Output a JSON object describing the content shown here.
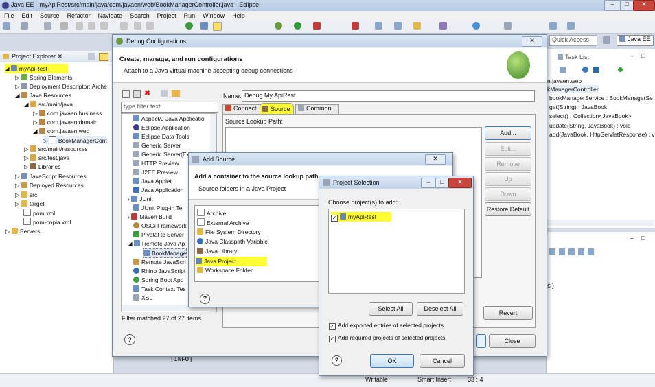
{
  "window": {
    "title": "Java EE - myApiRest/src/main/java/com/javaen/web/BookManagerController.java - Eclipse",
    "min": "–",
    "max": "□",
    "close": "✕"
  },
  "menu": [
    "File",
    "Edit",
    "Source",
    "Refactor",
    "Navigate",
    "Search",
    "Project",
    "Run",
    "Window",
    "Help"
  ],
  "quick_access": "Quick Access",
  "perspective": "Java EE",
  "explorer": {
    "title": "Project Explorer ✕",
    "items": [
      "myApiRest",
      "Spring Elements",
      "Deployment Descriptor: Arche",
      "Java Resources",
      "src/main/java",
      "com.javaen.business",
      "com.javaen.domain",
      "com.javaen.web",
      "BookManagerCont",
      "src/main/resources",
      "src/test/java",
      "Libraries",
      "JavaScript Resources",
      "Deployed Resources",
      "src",
      "target",
      "pom.xml",
      "pom-copia.xml",
      "Servers"
    ]
  },
  "outline": {
    "task_list": "Task List",
    "items": [
      "n.javaen.web",
      "kManagerController",
      "bookManagerService : BookManagerSe",
      "get(String) : JavaBook",
      "select() : Collection<JavaBook>",
      "update(String, JavaBook) : void",
      "add(JavaBook, HttpServletResponse) : v"
    ],
    "right_fragment": "c)"
  },
  "status": {
    "writable": "Writable",
    "insert": "Smart Insert",
    "pos": "33 : 4",
    "console": "[INFO]"
  },
  "debug": {
    "title": "Debug Configurations",
    "heading": "Create, manage, and run configurations",
    "subheading": "Attach to a Java virtual machine accepting debug connections",
    "filter_placeholder": "type filter text",
    "tree": [
      "Aspect/J Java Applicatio",
      "Eclipse Application",
      "Eclipse Data Tools",
      "Generic Server",
      "Generic Server(Ex",
      "HTTP Preview",
      "J2EE Preview",
      "Java Applet",
      "Java Application",
      "JUnit",
      "JUnit Plug-in Te",
      "Maven Build",
      "OSGi Framework",
      "Pivotal tc Server",
      "Remote Java Ap",
      "BookManage",
      "Remote JavaScri",
      "Rhino JavaScript",
      "Spring Boot App",
      "Task Context Tes",
      "XSL"
    ],
    "filter_status": "Filter matched 27 of 27 items",
    "name_label": "Name:",
    "name_value": "Debug My ApiRest",
    "tabs": [
      "Connect",
      "Source",
      "Common"
    ],
    "lookup_label": "Source Lookup Path:",
    "buttons": [
      "Add...",
      "Edit...",
      "Remove",
      "Up",
      "Down",
      "Restore Default"
    ],
    "revert": "Revert",
    "close": "Close"
  },
  "add_source": {
    "title": "Add Source",
    "heading": "Add a container to the source lookup path",
    "sub": "Source folders in a Java Project",
    "items": [
      "Archive",
      "External Archive",
      "File System Directory",
      "Java Classpath Variable",
      "Java Library",
      "Java Project",
      "Workspace Folder"
    ]
  },
  "project_selection": {
    "title": "Project Selection",
    "label": "Choose project(s) to add:",
    "project": "myApiRest",
    "select_all": "Select All",
    "deselect_all": "Deselect All",
    "opt1": "Add exported entries of selected projects.",
    "opt2": "Add required projects of selected projects.",
    "ok": "OK",
    "cancel": "Cancel"
  }
}
